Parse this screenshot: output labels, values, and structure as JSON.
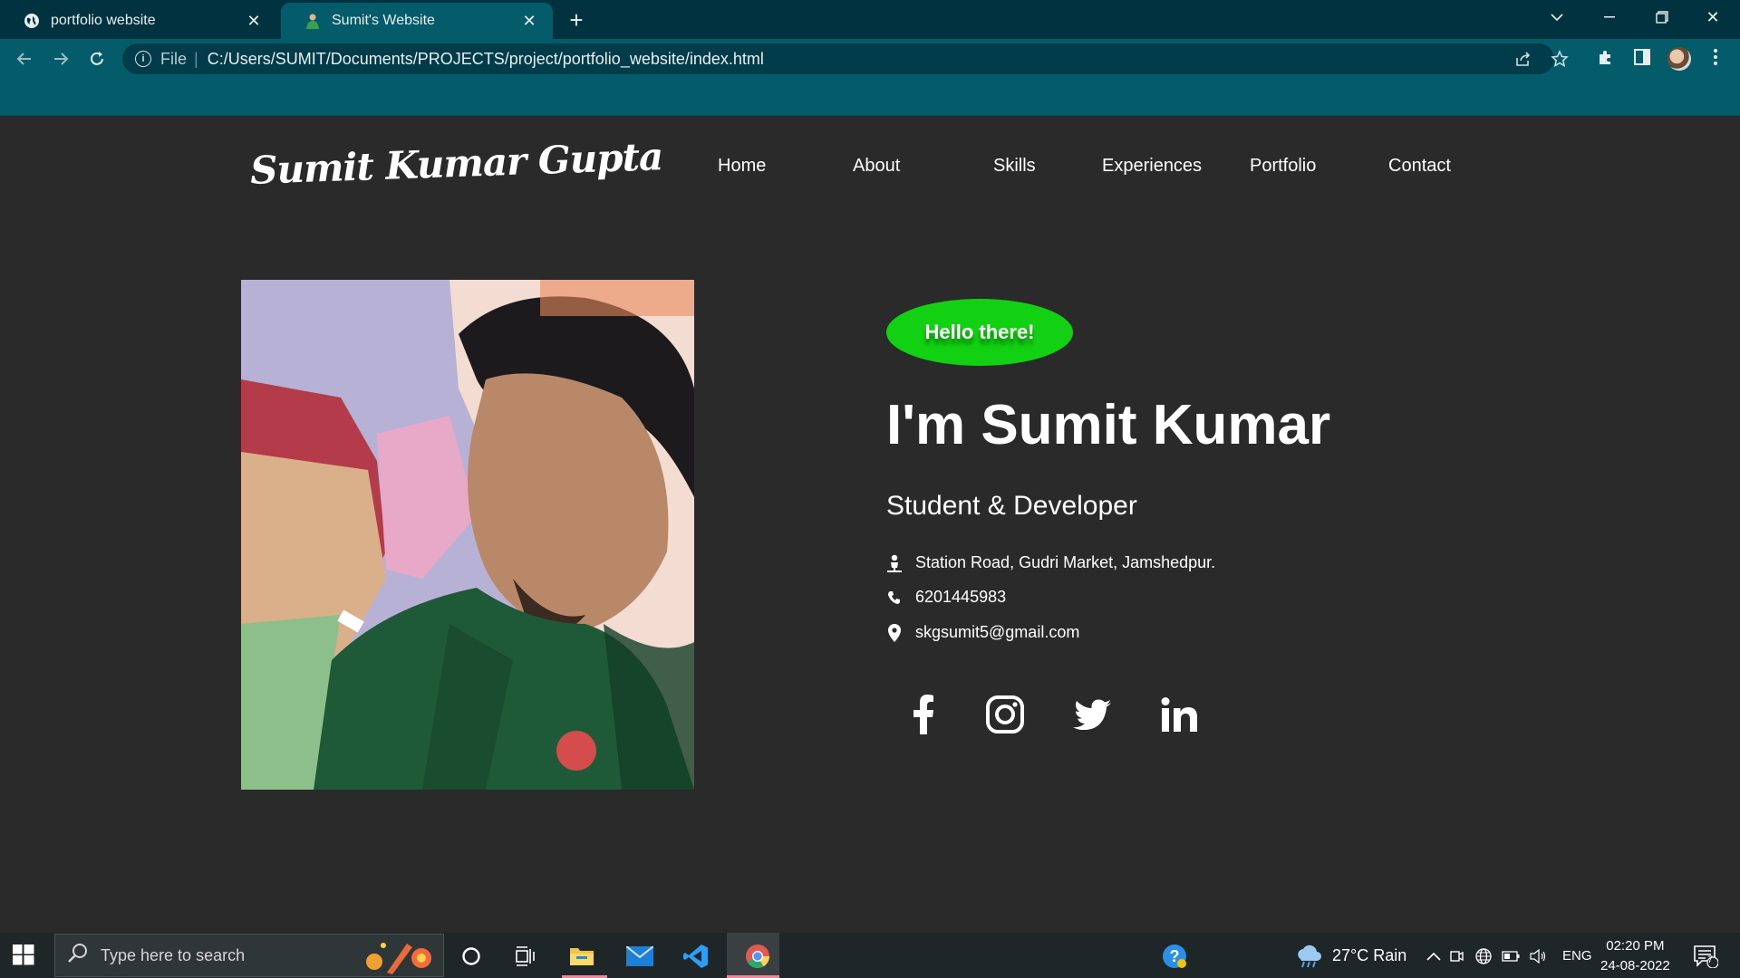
{
  "browser": {
    "tabs": [
      {
        "title": "portfolio website",
        "icon": "globe-icon",
        "active": false
      },
      {
        "title": "Sumit's Website",
        "icon": "person-favicon",
        "active": true
      }
    ],
    "address": {
      "scheme": "File",
      "url": "C:/Users/SUMIT/Documents/PROJECTS/project/portfolio_website/index.html"
    },
    "colors": {
      "tabbar": "#00333f",
      "toolbar": "#045c6b"
    }
  },
  "site": {
    "logo": "Sumit Kumar Gupta",
    "nav": [
      "Home",
      "About",
      "Skills",
      "Experiences",
      "Portfolio",
      "Contact"
    ],
    "hero": {
      "greeting": "Hello there!",
      "headline": "I'm Sumit Kumar",
      "subtitle": "Student & Developer",
      "address": "Station Road, Gudri Market, Jamshedpur.",
      "phone": "6201445983",
      "email": "skgsumit5@gmail.com",
      "social": [
        "facebook-icon",
        "instagram-icon",
        "twitter-icon",
        "linkedin-icon"
      ]
    },
    "colors": {
      "background": "#2a2a2a",
      "greeting_badge": "#12d112",
      "text": "#ffffff"
    }
  },
  "taskbar": {
    "search_placeholder": "Type here to search",
    "weather": "27°C  Rain",
    "language": "ENG",
    "time": "02:20 PM",
    "date": "24-08-2022",
    "notification_count": "7"
  }
}
